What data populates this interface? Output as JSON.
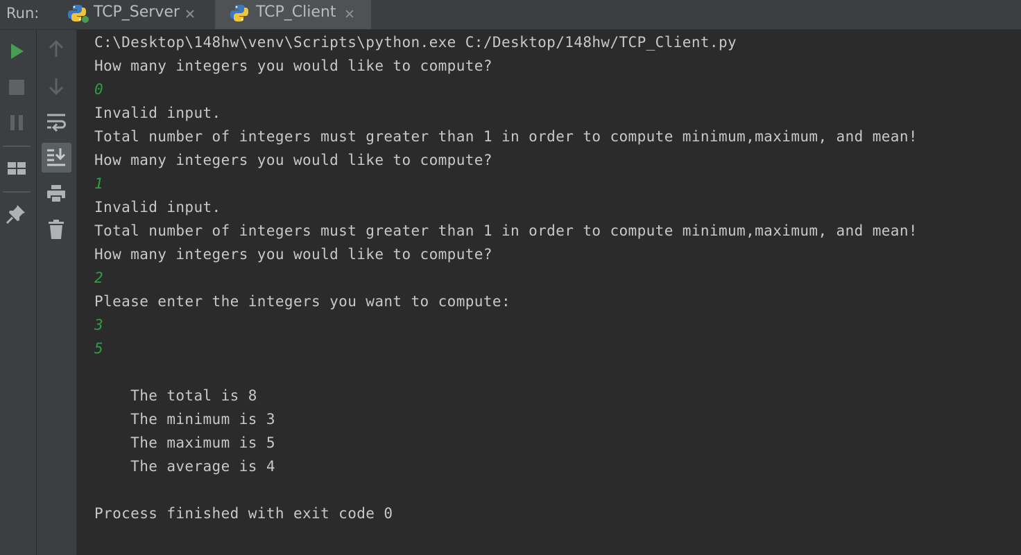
{
  "run_panel": {
    "label": "Run:",
    "tabs": [
      {
        "label": "TCP_Server",
        "icon": "python-file-icon"
      },
      {
        "label": "TCP_Client",
        "icon": "python-file-icon"
      }
    ]
  },
  "console": {
    "lines": [
      {
        "text": "C:\\Desktop\\148hw\\venv\\Scripts\\python.exe C:/Desktop/148hw/TCP_Client.py",
        "kind": "out"
      },
      {
        "text": "How many integers you would like to compute?",
        "kind": "out"
      },
      {
        "text": "0",
        "kind": "in"
      },
      {
        "text": "Invalid input.",
        "kind": "out"
      },
      {
        "text": "Total number of integers must greater than 1 in order to compute minimum,maximum, and mean!",
        "kind": "out"
      },
      {
        "text": "How many integers you would like to compute?",
        "kind": "out"
      },
      {
        "text": "1",
        "kind": "in"
      },
      {
        "text": "Invalid input.",
        "kind": "out"
      },
      {
        "text": "Total number of integers must greater than 1 in order to compute minimum,maximum, and mean!",
        "kind": "out"
      },
      {
        "text": "How many integers you would like to compute?",
        "kind": "out"
      },
      {
        "text": "2",
        "kind": "in"
      },
      {
        "text": "Please enter the integers you want to compute:",
        "kind": "out"
      },
      {
        "text": "3",
        "kind": "in"
      },
      {
        "text": "5",
        "kind": "in"
      },
      {
        "text": "",
        "kind": "out"
      },
      {
        "text": "    The total is 8",
        "kind": "out"
      },
      {
        "text": "    The minimum is 3",
        "kind": "out"
      },
      {
        "text": "    The maximum is 5",
        "kind": "out"
      },
      {
        "text": "    The average is 4",
        "kind": "out"
      },
      {
        "text": "",
        "kind": "out"
      },
      {
        "text": "Process finished with exit code 0",
        "kind": "out"
      }
    ]
  },
  "colors": {
    "background": "#2b2b2b",
    "panel": "#3c3f41",
    "text": "#c8c8c8",
    "user_input": "#2f9e44",
    "run_green": "#499c54"
  }
}
